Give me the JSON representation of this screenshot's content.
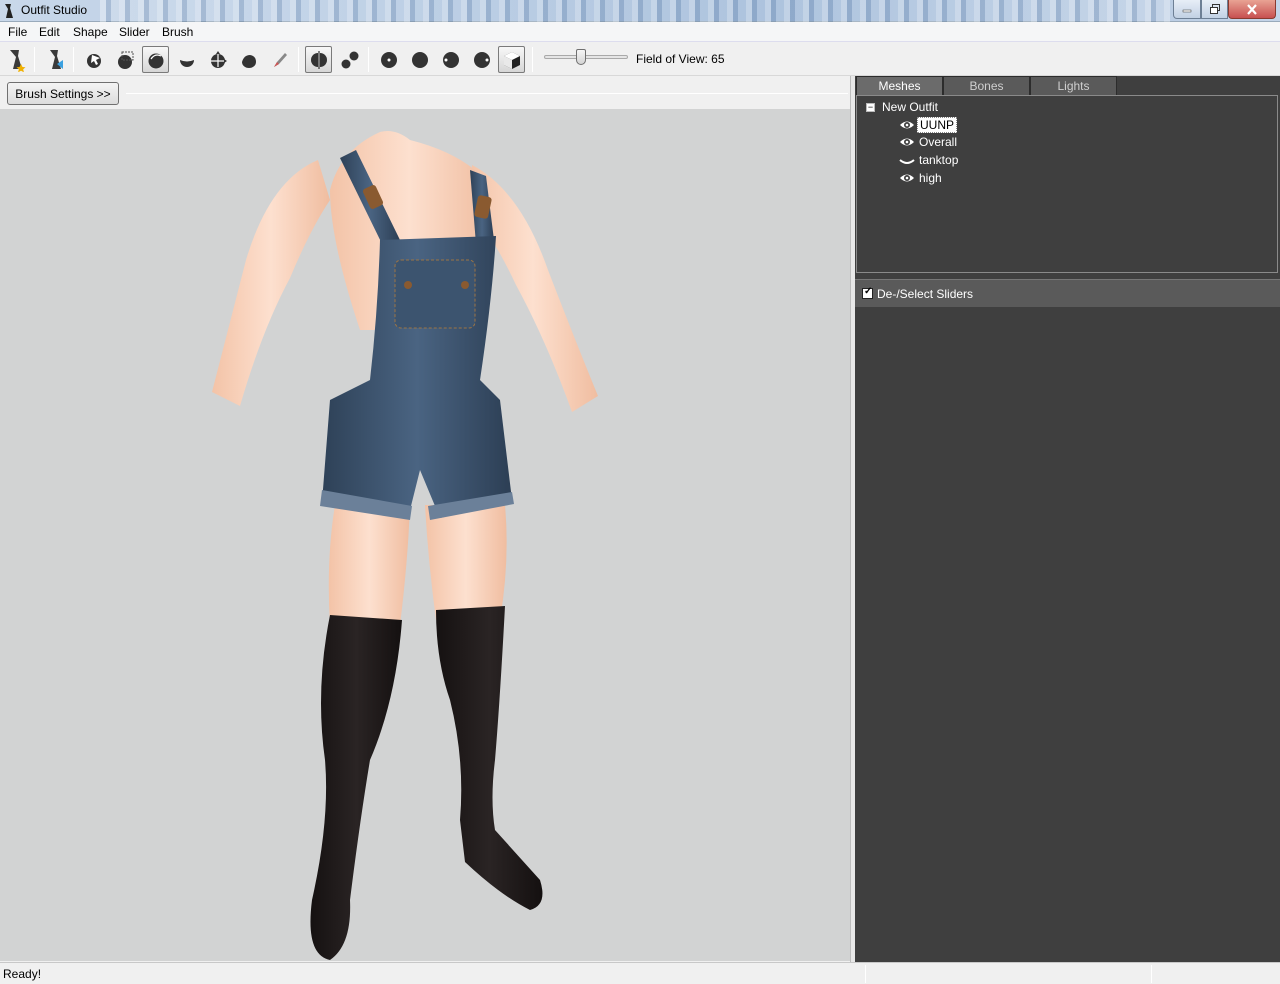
{
  "window": {
    "title": "Outfit Studio",
    "icons": {
      "app": "outfit-studio-icon",
      "minimize": "minimize-icon",
      "maximize": "restore-icon",
      "close": "close-icon"
    }
  },
  "menu": [
    "File",
    "Edit",
    "Shape",
    "Slider",
    "Brush"
  ],
  "toolbar": {
    "tools": [
      {
        "name": "new-project-tool-icon"
      },
      {
        "name": "load-reference-tool-icon"
      },
      {
        "name": "select-tool-icon"
      },
      {
        "name": "mask-tool-icon"
      },
      {
        "name": "inflate-brush-icon",
        "active": true
      },
      {
        "name": "deflate-brush-icon"
      },
      {
        "name": "move-brush-icon"
      },
      {
        "name": "smooth-brush-icon"
      },
      {
        "name": "weight-paint-icon"
      },
      {
        "name": "x-mirror-icon",
        "active": true
      },
      {
        "name": "connected-only-icon"
      },
      {
        "name": "view-front-icon"
      },
      {
        "name": "view-left-icon"
      },
      {
        "name": "view-right-icon"
      },
      {
        "name": "view-back-icon"
      },
      {
        "name": "perspective-view-icon",
        "active": true
      }
    ],
    "fov_label": "Field of View: 65",
    "fov_value": 65,
    "fov_range": [
      0,
      150
    ]
  },
  "brush_settings_label": "Brush Settings >>",
  "panel": {
    "tabs": [
      {
        "label": "Meshes",
        "active": true
      },
      {
        "label": "Bones",
        "active": false
      },
      {
        "label": "Lights",
        "active": false
      }
    ],
    "tree": {
      "root_label": "New Outfit",
      "toggle": "−",
      "meshes": [
        {
          "label": "UUNP",
          "visibility": "eye-icon",
          "selected": true
        },
        {
          "label": "Overall",
          "visibility": "eye-icon",
          "selected": false
        },
        {
          "label": "tanktop",
          "visibility": "eye-closed-icon",
          "selected": false
        },
        {
          "label": "high",
          "visibility": "eye-icon",
          "selected": false
        }
      ]
    },
    "sliders_header": "De-/Select Sliders",
    "sliders_checked": true
  },
  "status": {
    "text": "Ready!"
  },
  "colors": {
    "viewport_bg": "#d2d3d3",
    "panel_bg": "#3f3f3f",
    "tab_bg": "#5a5a5a"
  }
}
